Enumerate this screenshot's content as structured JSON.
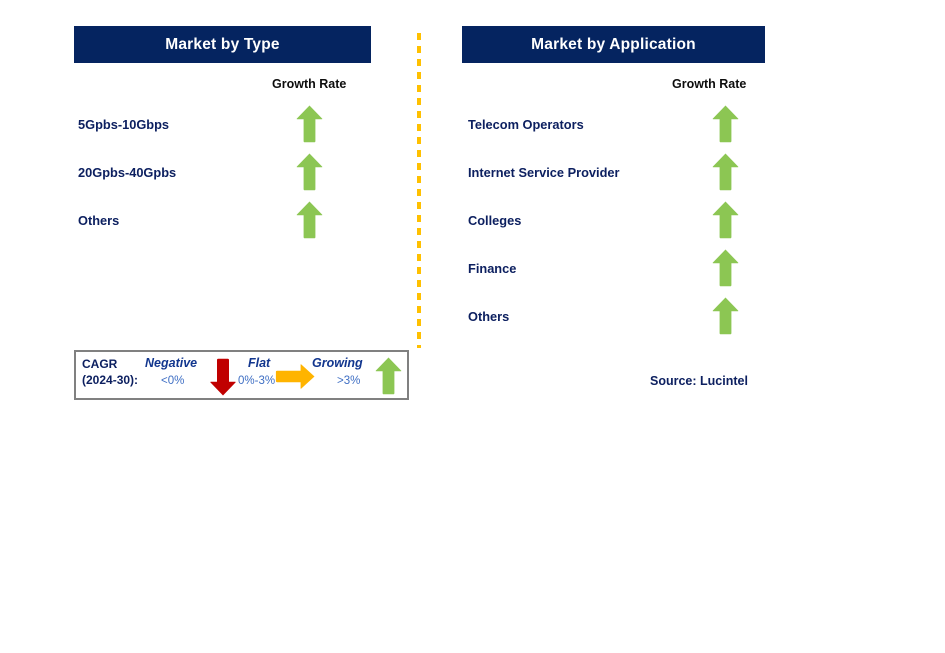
{
  "panels": [
    {
      "id": "type",
      "title": "Market by Type",
      "growth_rate_label": "Growth Rate",
      "rows": [
        {
          "label": "5Gpbs-10Gbps",
          "trend": "growing",
          "icon": "arrow-up-icon"
        },
        {
          "label": "20Gpbs-40Gpbs",
          "trend": "growing",
          "icon": "arrow-up-icon"
        },
        {
          "label": "Others",
          "trend": "growing",
          "icon": "arrow-up-icon"
        }
      ]
    },
    {
      "id": "application",
      "title": "Market by Application",
      "growth_rate_label": "Growth Rate",
      "rows": [
        {
          "label": "Telecom Operators",
          "trend": "growing",
          "icon": "arrow-up-icon"
        },
        {
          "label": "Internet Service Provider",
          "trend": "growing",
          "icon": "arrow-up-icon"
        },
        {
          "label": "Colleges",
          "trend": "growing",
          "icon": "arrow-up-icon"
        },
        {
          "label": "Finance",
          "trend": "growing",
          "icon": "arrow-up-icon"
        },
        {
          "label": "Others",
          "trend": "growing",
          "icon": "arrow-up-icon"
        }
      ]
    }
  ],
  "legend": {
    "title_line1": "CAGR",
    "title_line2": "(2024-30):",
    "entries": [
      {
        "term": "Negative",
        "range": "<0%",
        "icon": "arrow-down-icon",
        "color": "#c00000"
      },
      {
        "term": "Flat",
        "range": "0%-3%",
        "icon": "arrow-right-icon",
        "color": "#ffb400"
      },
      {
        "term": "Growing",
        "range": ">3%",
        "icon": "arrow-up-icon",
        "color": "#8cc653"
      }
    ]
  },
  "source": "Source: Lucintel",
  "colors": {
    "header_navy": "#052460",
    "label_navy": "#0d2060",
    "growing_green": "#8cc653",
    "negative_red": "#c00000",
    "flat_orange": "#ffb400",
    "divider_gold": "#ffc000",
    "legend_border_gray": "#808080"
  }
}
